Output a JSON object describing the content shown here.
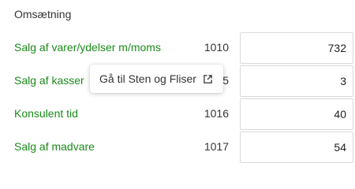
{
  "section": {
    "title": "Omsætning"
  },
  "rows": [
    {
      "label": "Salg af varer/ydelser m/moms",
      "code": "1010",
      "value": "732"
    },
    {
      "label": "Salg af kasser",
      "code": "1015",
      "value": "3"
    },
    {
      "label": "Konsulent tid",
      "code": "1016",
      "value": "40"
    },
    {
      "label": "Salg af madvare",
      "code": "1017",
      "value": "54"
    }
  ],
  "tooltip": {
    "text": "Gå til Sten og Fliser",
    "icon": "external-link-icon"
  },
  "colors": {
    "label_green": "#1a8a1a",
    "text": "#333333",
    "input_border": "#d9d9d9"
  }
}
